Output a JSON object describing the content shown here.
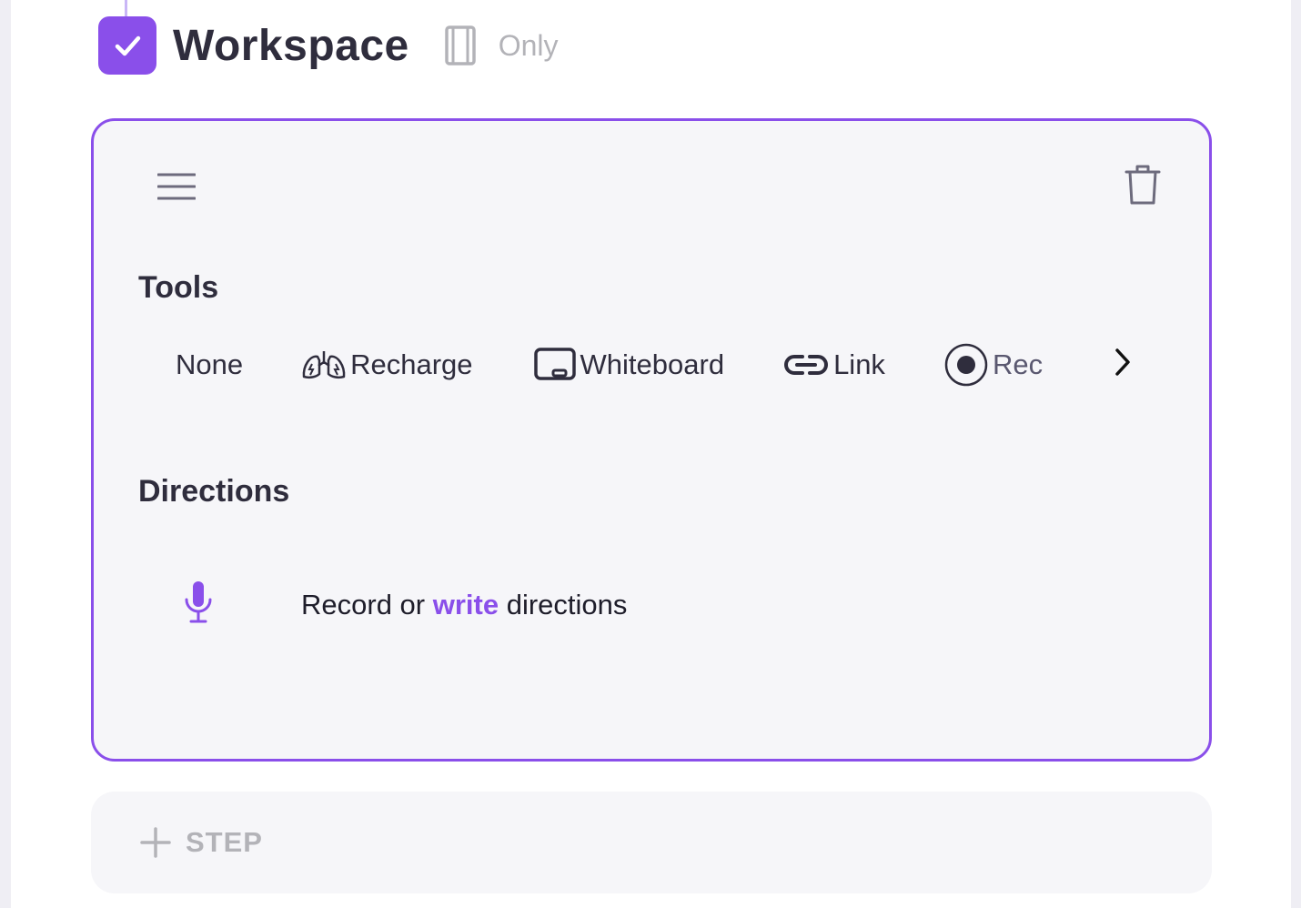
{
  "header": {
    "title": "Workspace",
    "checked": true,
    "scope_icon": "film-strip-icon",
    "scope_label": "Only"
  },
  "card": {
    "menu_icon": "hamburger-menu-icon",
    "delete_icon": "trash-icon",
    "tools": {
      "label": "Tools",
      "items": [
        {
          "label": "None",
          "icon": null
        },
        {
          "label": "Recharge",
          "icon": "lungs-icon"
        },
        {
          "label": "Whiteboard",
          "icon": "whiteboard-icon"
        },
        {
          "label": "Link",
          "icon": "link-icon"
        },
        {
          "label": "Rec",
          "icon": "record-icon"
        }
      ],
      "scroll_icon": "chevron-right-icon"
    },
    "directions": {
      "label": "Directions",
      "icon": "microphone-icon",
      "text_before": "Record or ",
      "link": "write",
      "text_after": " directions"
    }
  },
  "add_step": {
    "icon": "plus-icon",
    "label": "STEP"
  },
  "colors": {
    "accent": "#8a4fea",
    "text_dark": "#2f2d3d",
    "muted": "#b3b3b8",
    "card_bg": "#f6f6f9"
  }
}
